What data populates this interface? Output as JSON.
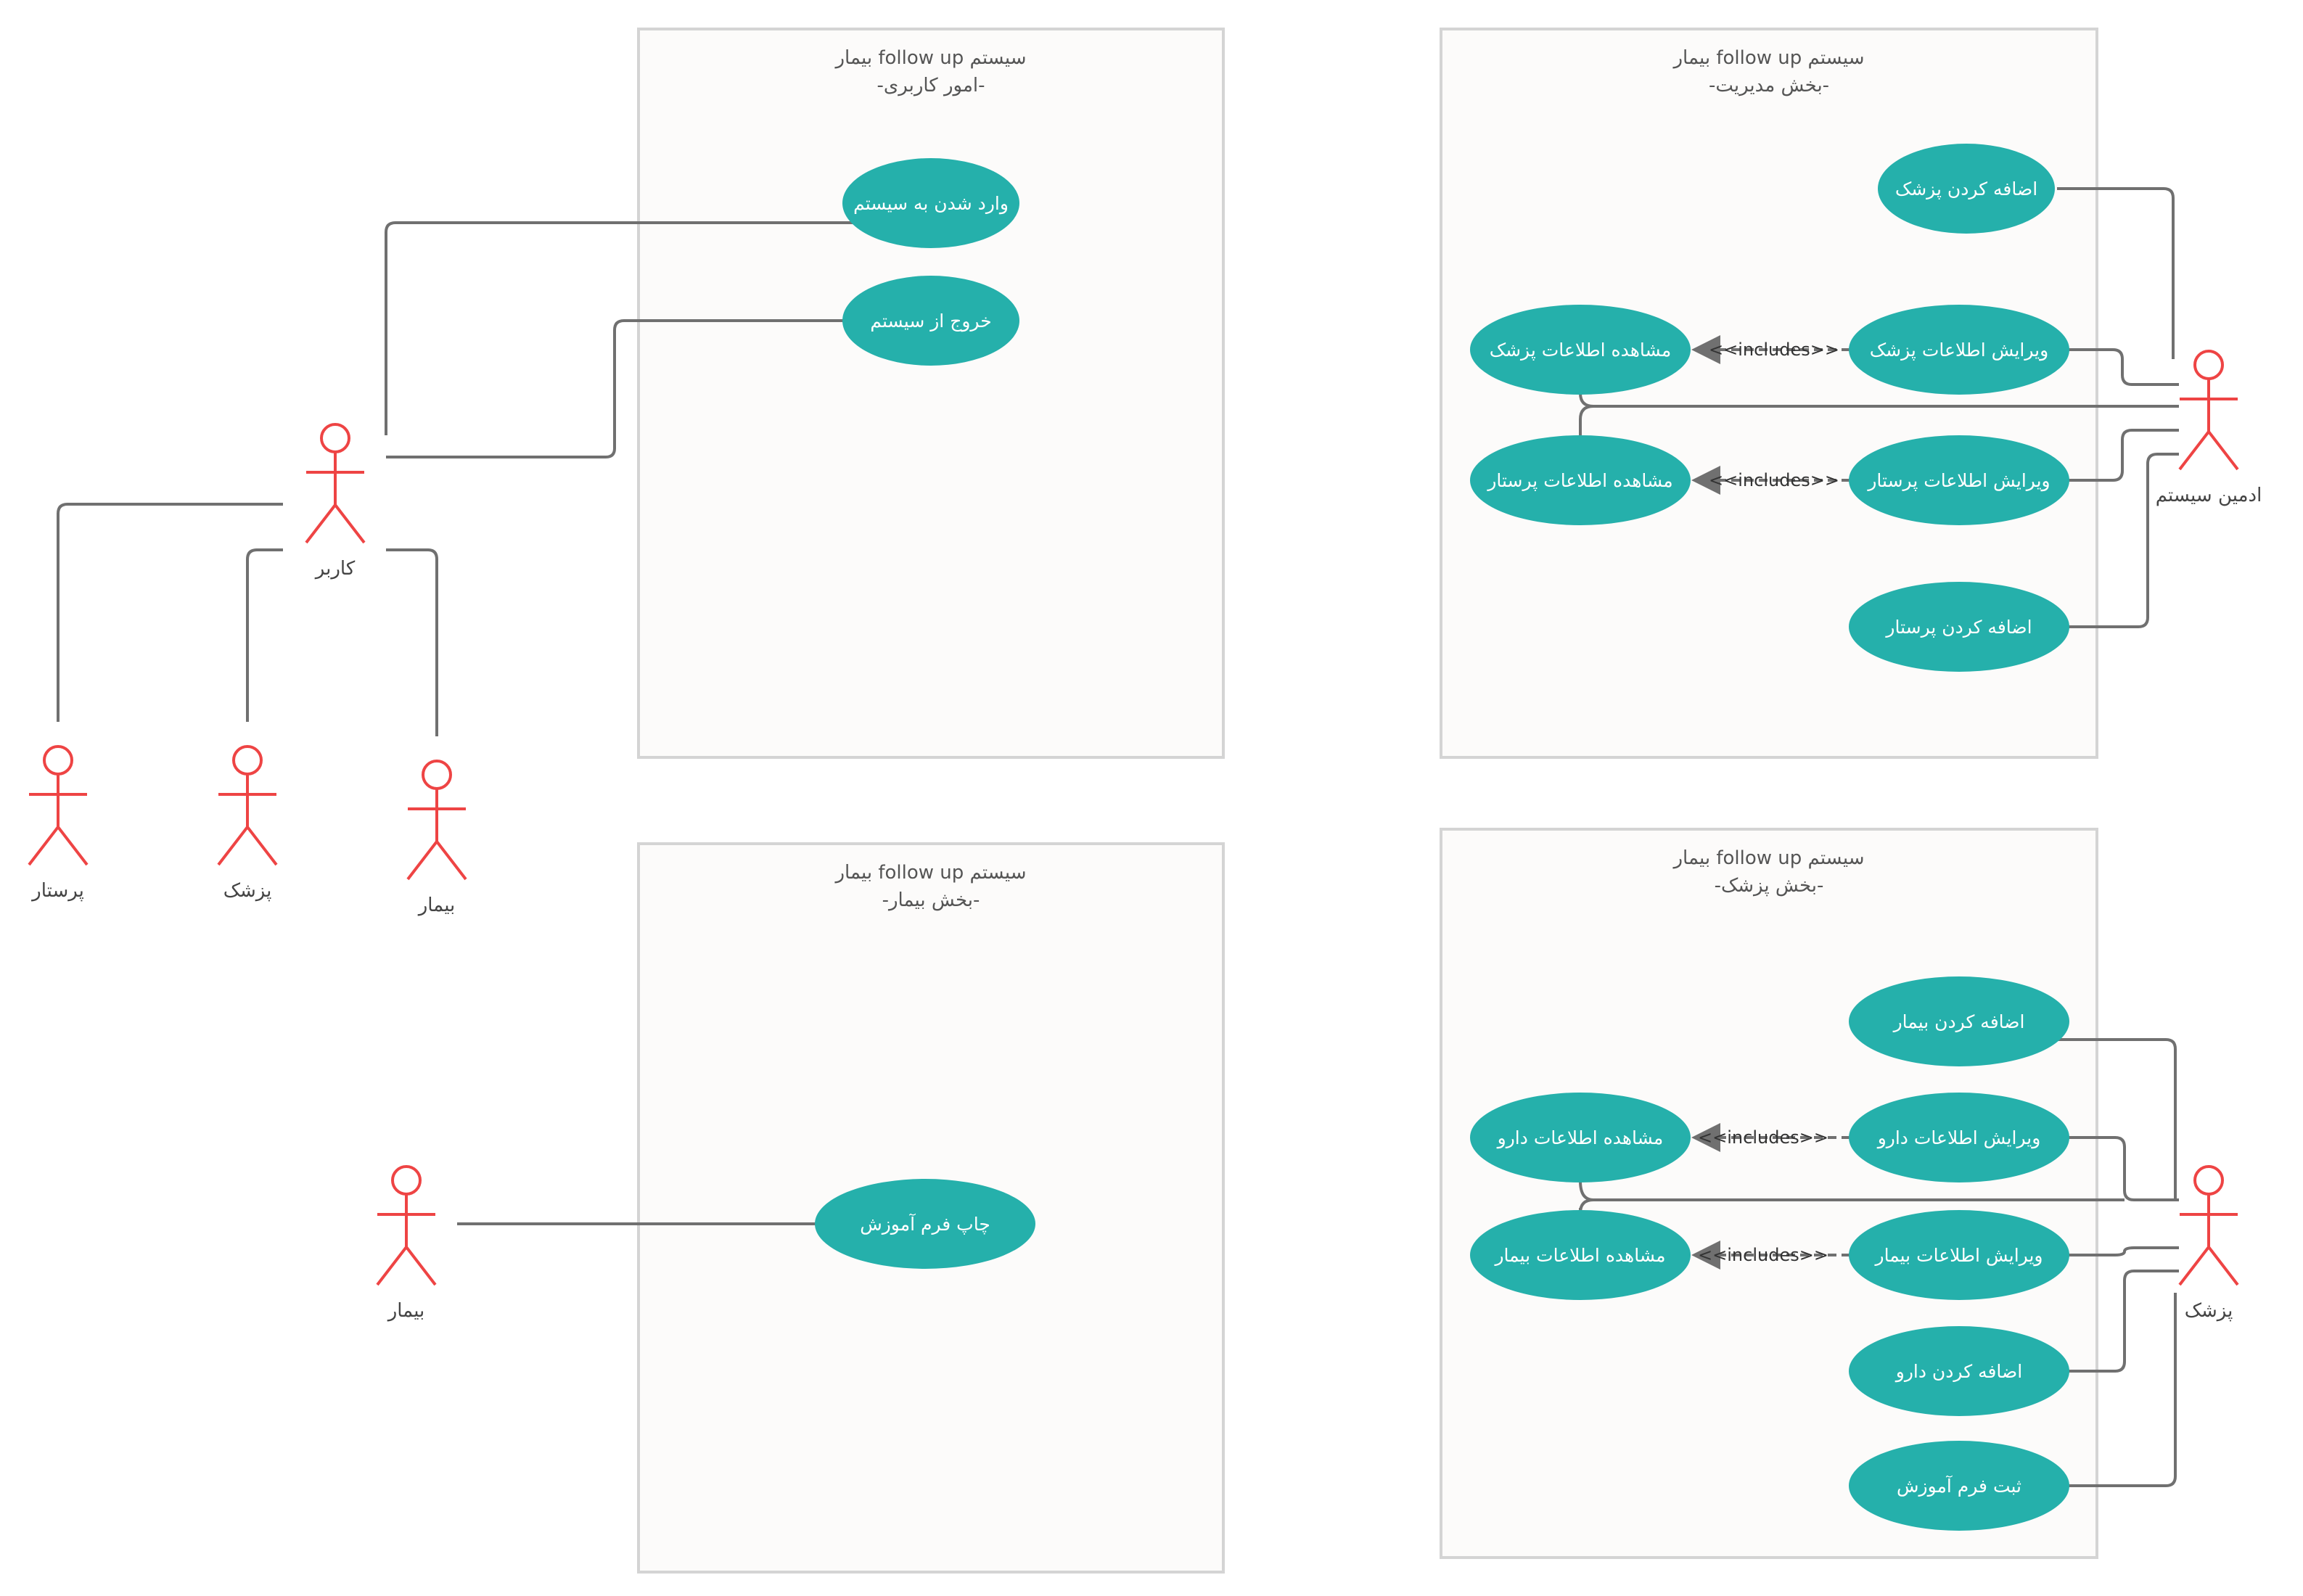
{
  "boundaries": {
    "user": {
      "title": "سیستم follow up بیمار",
      "subtitle": "-امور کاربری-"
    },
    "admin": {
      "title": "سیستم follow up بیمار",
      "subtitle": "-بخش مدیریت-"
    },
    "patient": {
      "title": "سیستم follow up بیمار",
      "subtitle": "-بخش بیمار-"
    },
    "doctor": {
      "title": "سیستم follow up بیمار",
      "subtitle": "-بخش پزشک-"
    }
  },
  "actors": {
    "user": "کاربر",
    "nurse": "پرستار",
    "doctor_sub": "پزشک",
    "patient_sub": "بیمار",
    "admin": "ادمین سیستم",
    "patient": "بیمار",
    "doctor": "پزشک"
  },
  "usecases": {
    "login": "وارد شدن به سیستم",
    "logout": "خروج از سیستم",
    "add_doctor": "اضافه کردن پزشک",
    "edit_doctor": "ویرایش اطلاعات پزشک",
    "view_doctor": "مشاهده اطلاعات پزشک",
    "edit_nurse": "ویرایش اطلاعات پرستار",
    "view_nurse": "مشاهده اطلاعات پرستار",
    "add_nurse": "اضافه کردن پرستار",
    "print_form": "چاپ فرم آموزش",
    "add_patient": "اضافه کردن بیمار",
    "edit_drug": "ویرایش اطلاعات دارو",
    "view_drug": "مشاهده اطلاعات دارو",
    "edit_patient": "ویرایش اطلاعات بیمار",
    "view_patient": "مشاهده اطلاعات بیمار",
    "add_drug": "اضافه کردن دارو",
    "register_form": "ثبت فرم آموزش"
  },
  "relations": {
    "admin_doctor": "<<includes>>",
    "admin_nurse": "<<includes>>",
    "doctor_drug": "<<includes>>",
    "doctor_patient": "<<includes>>"
  },
  "colors": {
    "usecase_fill": "#25b0ab",
    "actor_stroke": "#ee4444",
    "line": "#707070",
    "boundary_fill": "#fcfbfa",
    "boundary_stroke": "#d4d4d4"
  }
}
